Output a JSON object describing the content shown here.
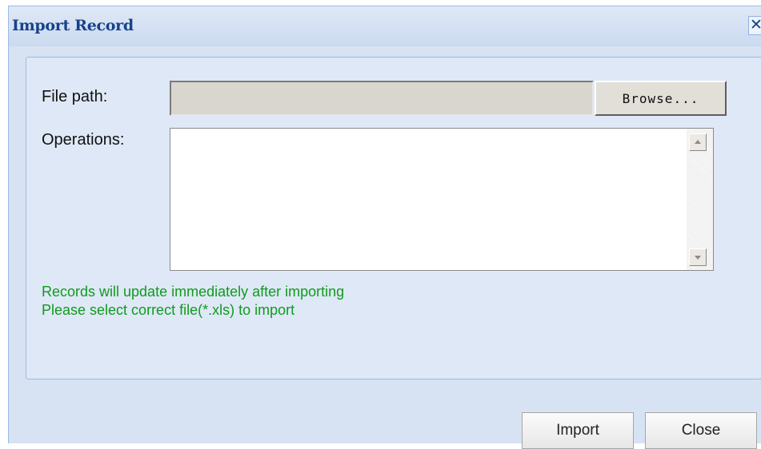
{
  "dialog": {
    "title": "Import Record",
    "close_glyph": "✕"
  },
  "form": {
    "file_path_label": "File path:",
    "file_path_value": "",
    "browse_label": "Browse...",
    "operations_label": "Operations:",
    "operations_value": ""
  },
  "notes": {
    "line1": "Records will update immediately after importing",
    "line2": "Please select correct file(*.xls) to import"
  },
  "footer": {
    "import_label": "Import",
    "close_label": "Close"
  },
  "colors": {
    "title_text": "#15428b",
    "panel_bg": "#dfe8f6",
    "dialog_bg": "#d7e3f3",
    "note_text": "#0f9b1f",
    "input_bg": "#d9d6cf"
  },
  "icons": {
    "close": "close-icon",
    "scroll_up": "arrow-up-icon",
    "scroll_down": "arrow-down-icon"
  }
}
